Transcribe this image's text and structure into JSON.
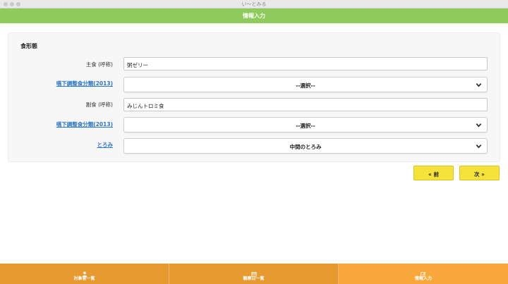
{
  "window": {
    "title": "い～とみる"
  },
  "header": {
    "title": "情報入力"
  },
  "form": {
    "section_title": "食形態",
    "staple": {
      "label": "主食 (呼称)",
      "value": "粥ゼリー"
    },
    "staple_class": {
      "label": "嚥下調整食分類(2013)",
      "value": "--選択--"
    },
    "side": {
      "label": "副食 (呼称)",
      "value": "みじんトロミ食"
    },
    "side_class": {
      "label": "嚥下調整食分類(2013)",
      "value": "--選択--"
    },
    "thickness": {
      "label": "とろみ",
      "value": "中間のとろみ"
    }
  },
  "nav": {
    "prev_label": "« 前",
    "next_label": "次 »"
  },
  "footer": {
    "tabs": [
      {
        "label": "対象者一覧",
        "icon": "user-icon"
      },
      {
        "label": "観察日一覧",
        "icon": "calendar-icon"
      },
      {
        "label": "情報入力",
        "icon": "edit-icon"
      }
    ]
  },
  "colors": {
    "header": "#8fcb5c",
    "footer": "#e79a2f",
    "footer_active": "#f8a83a",
    "button": "#f6e33a",
    "link": "#2a76c6"
  }
}
